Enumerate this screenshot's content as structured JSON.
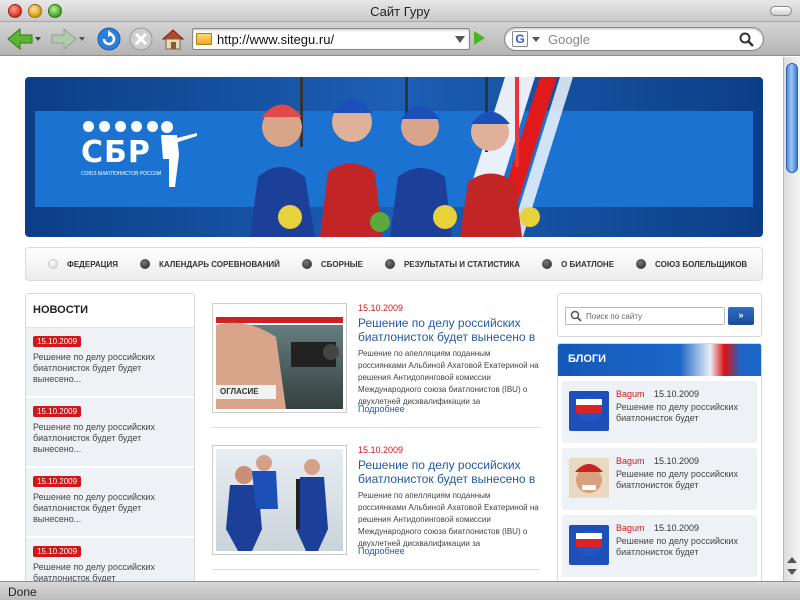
{
  "window": {
    "title": "Сайт Гуру"
  },
  "browser": {
    "url": "http://www.sitegu.ru/",
    "search_placeholder": "Google",
    "search_engine_letter": "G",
    "status": "Done"
  },
  "banner": {
    "logo_text": "СБР",
    "logo_subtitle": "союз биатлонистов россии"
  },
  "nav": {
    "items": [
      "Федерация",
      "Календарь соревнований",
      "Сборные",
      "Результаты и статистика",
      "О биатлоне",
      "Союз болельщиков"
    ]
  },
  "news": {
    "heading": "НОВОСТИ",
    "items": [
      {
        "date": "15.10.2009",
        "text": "Решение по делу российских биатлонисток будет будет вынесено..."
      },
      {
        "date": "15.10.2009",
        "text": "Решение по делу российских биатлонисток будет будет вынесено..."
      },
      {
        "date": "15.10.2009",
        "text": "Решение по делу российских биатлонисток будет будет вынесено..."
      },
      {
        "date": "15.10.2009",
        "text": "Решение по делу российских биатлонисток будет"
      }
    ]
  },
  "articles": [
    {
      "date": "15.10.2009",
      "title": "Решение по делу российских биатлонисток будет вынесено в",
      "body": "Решение по апелляциям поданным россиянками Альбиной Ахатовой Екатериной на решения Антидопинговой комиссии Международного союза биатлонистов (IBU) о двухлетней дисквалификации за",
      "more": "Подробнее",
      "thumb_caption": "ОГЛАСИЕ"
    },
    {
      "date": "15.10.2009",
      "title": "Решение по делу российских биатлонисток будет вынесено в",
      "body": "Решение по апелляциям поданным россиянками Альбиной Ахатовой Екатериной на решения Антидопинговой комиссии Международного союза биатлонистов (IBU) о двухлетней дисквалификации за",
      "more": "Подробнее"
    }
  ],
  "site_search": {
    "placeholder": "Поиск по сайту",
    "button": "»"
  },
  "blogs": {
    "heading": "БЛОГИ",
    "items": [
      {
        "author": "Bagum",
        "date": "15.10.2009",
        "text": "Решение по делу российских биатлонисток будет"
      },
      {
        "author": "Bagum",
        "date": "15.10.2009",
        "text": "Решение по делу российских биатлонисток будет"
      },
      {
        "author": "Bagum",
        "date": "15.10.2009",
        "text": "Решение по делу российских биатлонисток будет"
      }
    ]
  },
  "colors": {
    "accent_blue": "#2459a8",
    "date_red": "#d01818",
    "banner_blue": "#1b72d0"
  }
}
